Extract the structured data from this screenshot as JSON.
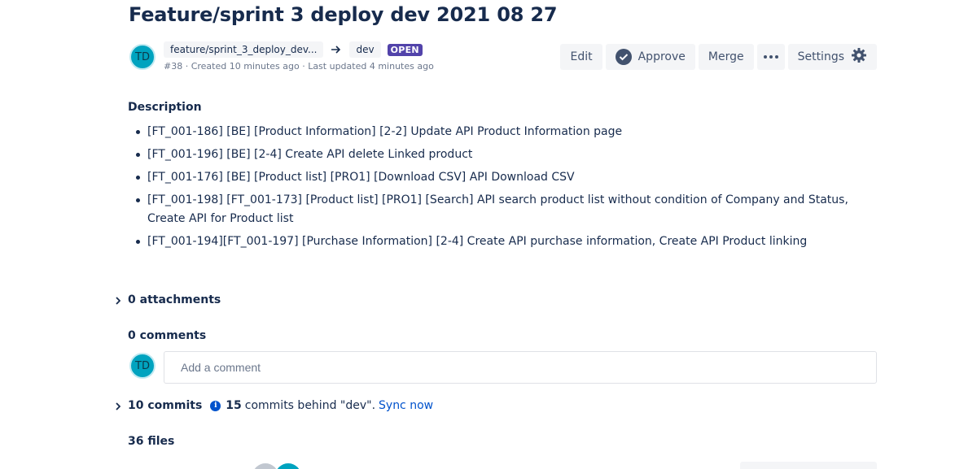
{
  "pr": {
    "title": "Feature/sprint 3 deploy dev 2021 08 27",
    "author_initials": "TD",
    "source_branch": "feature/sprint_3_deploy_dev...",
    "target_branch": "dev",
    "state": "OPEN",
    "meta": "#38 · Created 10 minutes ago · Last updated 4 minutes ago"
  },
  "actions": {
    "edit": "Edit",
    "approve": "Approve",
    "merge": "Merge",
    "settings": "Settings"
  },
  "description": {
    "heading": "Description",
    "items": [
      "[FT_001-186] [BE] [Product Information] [2-2] Update API Product Information page",
      "[FT_001-196] [BE] [2-4] Create API delete Linked product",
      "[FT_001-176] [BE] [Product list] [PRO1] [Download CSV] API Download CSV",
      "[FT_001-198] [FT_001-173] [Product list] [PRO1] [Search] API search product list without condition of Company and Status, Create API for Product list",
      "[FT_001-194][FT_001-197] [Purchase Information] [2-4] Create API purchase information, Create API Product linking"
    ]
  },
  "attachments": {
    "label": "0 attachments"
  },
  "comments": {
    "label": "0 comments",
    "avatar_initials": "TD",
    "placeholder": "Add a comment"
  },
  "commits": {
    "count_label": "10 commits",
    "behind_count": "15",
    "behind_text": "commits behind \"dev\".",
    "sync_label": "Sync now"
  },
  "files": {
    "label": "36 files"
  },
  "colors": {
    "accent": "#0052cc",
    "lozenge": "#5243aa",
    "avatar": "#00a3bf",
    "text": "#172b4d"
  }
}
